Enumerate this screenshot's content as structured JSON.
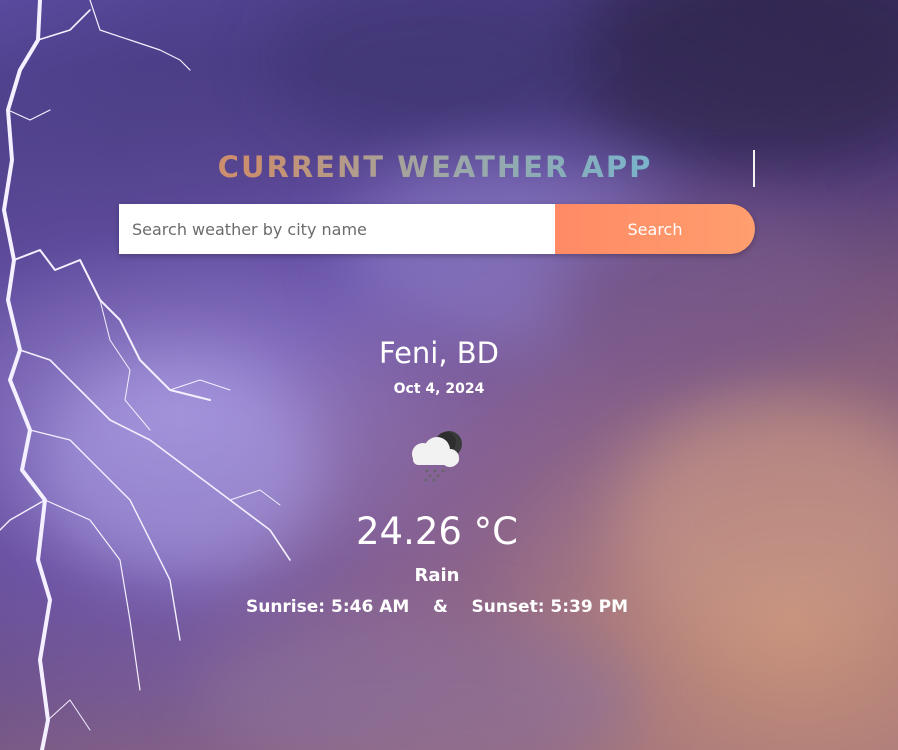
{
  "header": {
    "title": "CURRENT WEATHER APP"
  },
  "search": {
    "placeholder": "Search weather by city name",
    "value": "",
    "button_label": "Search"
  },
  "weather": {
    "location": "Feni, BD",
    "date": "Oct 4, 2024",
    "icon": "rain-cloud-night-icon",
    "temperature": "24.26 °C",
    "condition": "Rain",
    "sunrise": "Sunrise: 5:46 AM",
    "separator": "&",
    "sunset": "Sunset: 5:39 PM"
  },
  "colors": {
    "button": "#ff8a65",
    "title_start": "#e98a5c",
    "title_end": "#4fb5e0"
  }
}
